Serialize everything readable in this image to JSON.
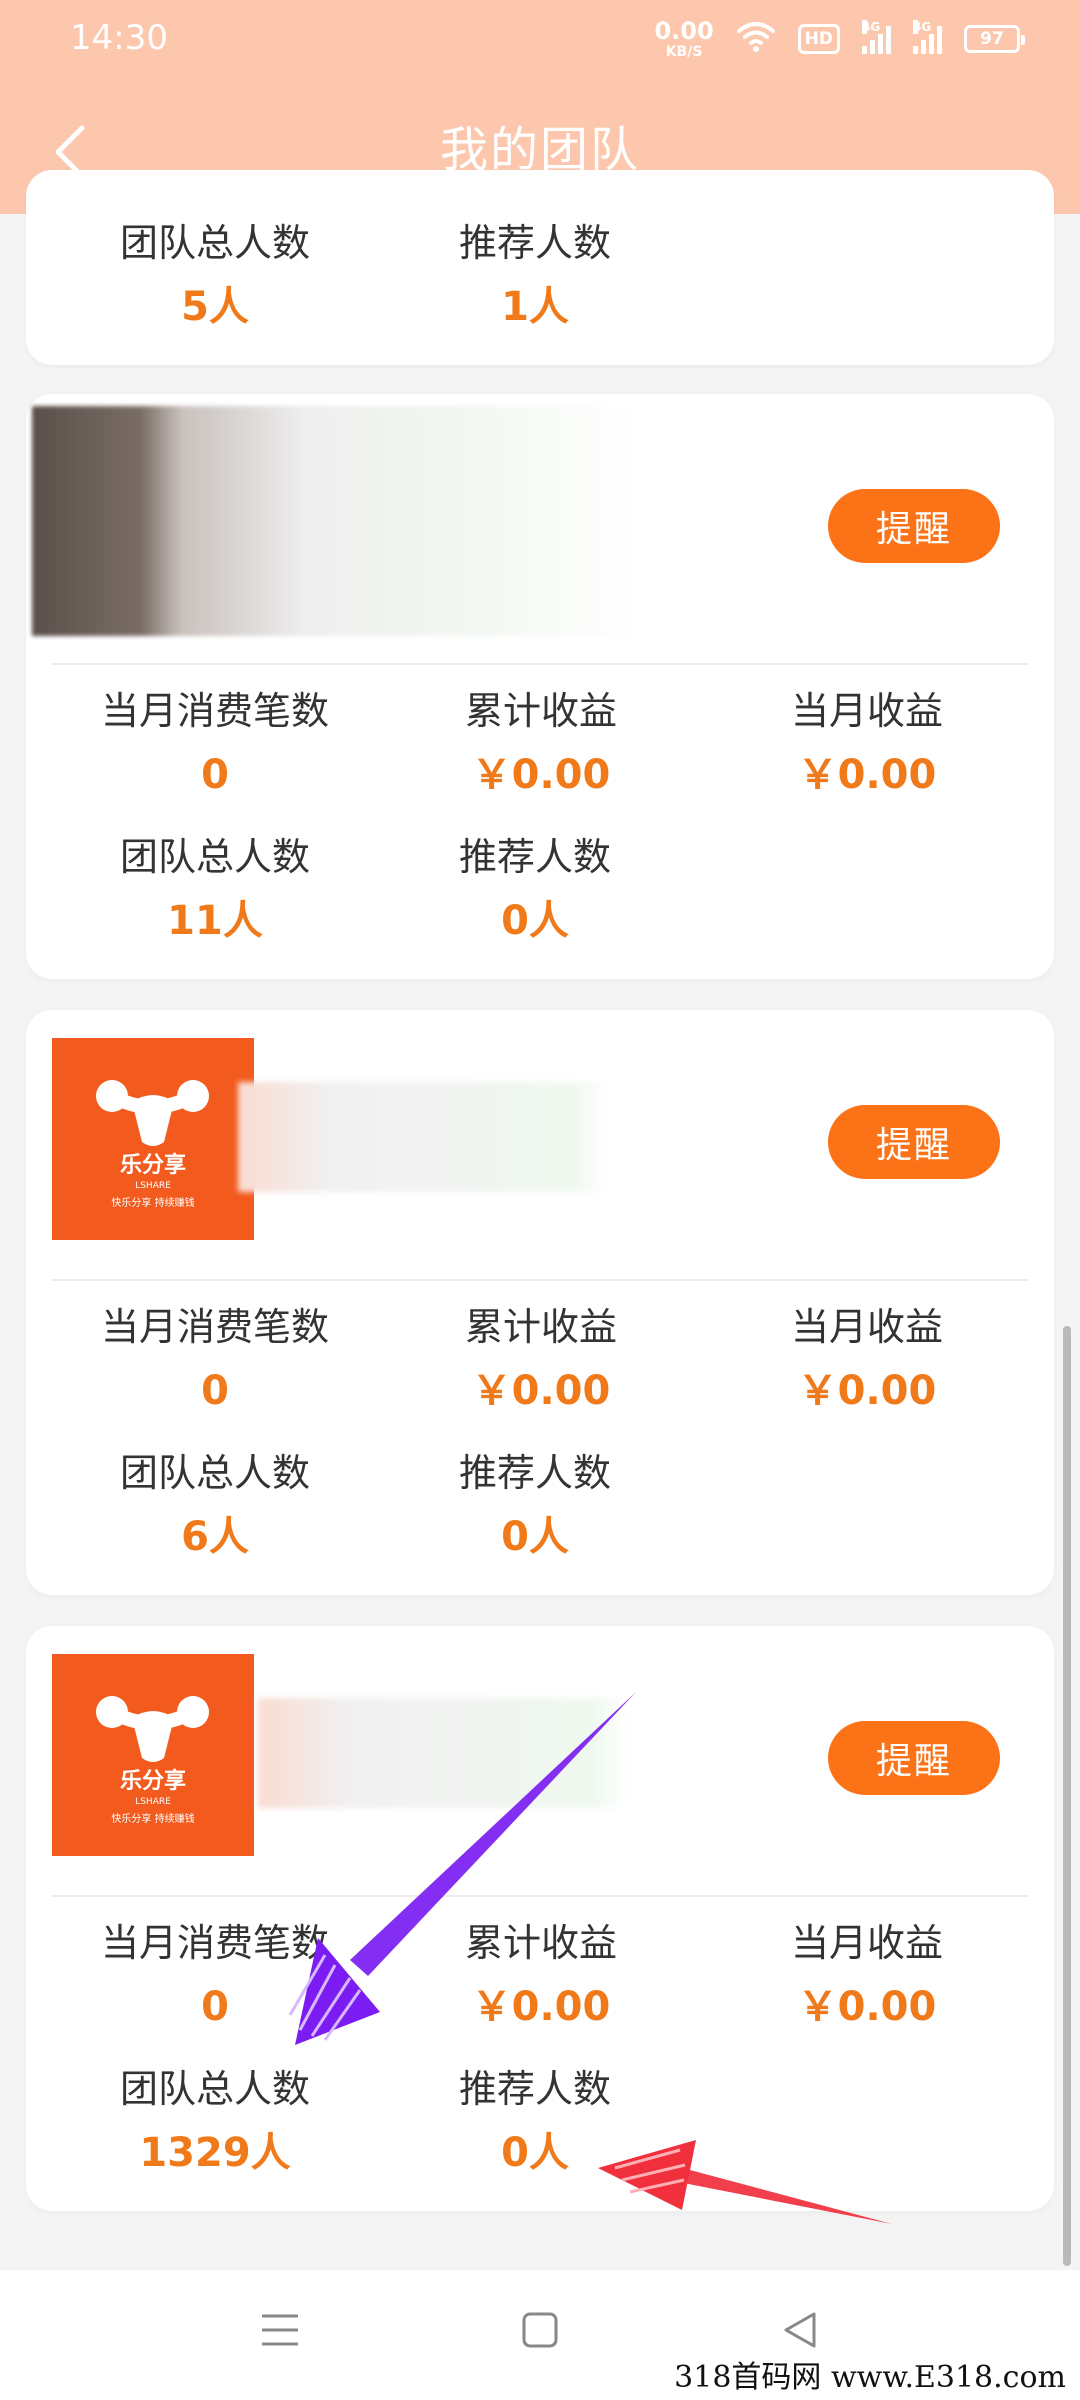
{
  "status_bar": {
    "time": "14:30",
    "net_speed_value": "0.00",
    "net_speed_unit": "KB/S",
    "hd_badge": "HD",
    "signal_1_label": "4G",
    "signal_2_label": "4G",
    "battery": "97",
    "icons": [
      "wifi-icon",
      "signal-icon",
      "battery-icon"
    ]
  },
  "header": {
    "title": "我的团队",
    "back_icon": "chevron-left-icon",
    "color": "#fcc7ad"
  },
  "accent_color": "#f07a1a",
  "button_color": "#fb7316",
  "cards": [
    {
      "stats_row2": {
        "team_total_label": "团队总人数",
        "team_total_value": "5人",
        "referrals_label": "推荐人数",
        "referrals_value": "1人"
      }
    },
    {
      "avatar": "blurred-photo",
      "remind_label": "提醒",
      "stats_row1": {
        "monthly_orders_label": "当月消费笔数",
        "monthly_orders_value": "0",
        "total_earnings_label": "累计收益",
        "total_earnings_value": "￥0.00",
        "monthly_earnings_label": "当月收益",
        "monthly_earnings_value": "￥0.00"
      },
      "stats_row2": {
        "team_total_label": "团队总人数",
        "team_total_value": "11人",
        "referrals_label": "推荐人数",
        "referrals_value": "0人"
      }
    },
    {
      "avatar": "lshare-logo",
      "logo_text": "乐分享",
      "logo_sub": "LSHARE",
      "logo_tagline": "快乐分享  持续赚钱",
      "remind_label": "提醒",
      "stats_row1": {
        "monthly_orders_label": "当月消费笔数",
        "monthly_orders_value": "0",
        "total_earnings_label": "累计收益",
        "total_earnings_value": "￥0.00",
        "monthly_earnings_label": "当月收益",
        "monthly_earnings_value": "￥0.00"
      },
      "stats_row2": {
        "team_total_label": "团队总人数",
        "team_total_value": "6人",
        "referrals_label": "推荐人数",
        "referrals_value": "0人"
      }
    },
    {
      "avatar": "lshare-logo",
      "logo_text": "乐分享",
      "logo_sub": "LSHARE",
      "logo_tagline": "快乐分享  持续赚钱",
      "remind_label": "提醒",
      "stats_row1": {
        "monthly_orders_label": "当月消费笔数",
        "monthly_orders_value": "0",
        "total_earnings_label": "累计收益",
        "total_earnings_value": "￥0.00",
        "monthly_earnings_label": "当月收益",
        "monthly_earnings_value": "￥0.00"
      },
      "stats_row2": {
        "team_total_label": "团队总人数",
        "team_total_value": "1329人",
        "referrals_label": "推荐人数",
        "referrals_value": "0人"
      }
    }
  ],
  "nav_bar": {
    "icons": [
      "menu-icon",
      "home-square-icon",
      "back-triangle-icon"
    ]
  },
  "annotations": {
    "arrow_1_color": "#7b1cf2",
    "arrow_2_color": "#f0303c"
  },
  "watermark": "318首码网 www.E318.com"
}
